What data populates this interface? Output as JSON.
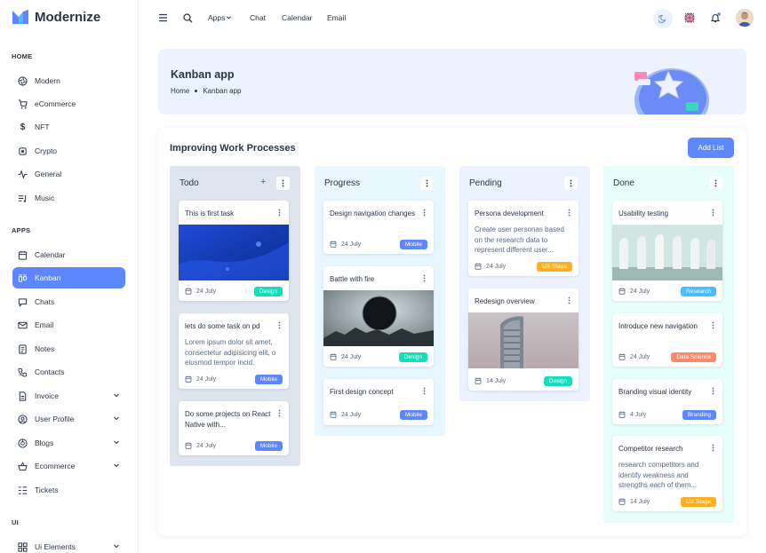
{
  "app": {
    "name": "Modernize"
  },
  "sidebar": {
    "sections": [
      {
        "caption": "HOME"
      },
      {
        "caption": "APPS"
      },
      {
        "caption": "UI"
      }
    ],
    "items": [
      {
        "label": "Modern",
        "icon": "aperture-icon"
      },
      {
        "label": "eCommerce",
        "icon": "shopping-cart-icon"
      },
      {
        "label": "NFT",
        "icon": "currency-dollar-icon"
      },
      {
        "label": "Crypto",
        "icon": "cpu-icon"
      },
      {
        "label": "General",
        "icon": "activity-icon"
      },
      {
        "label": "Music",
        "icon": "playlist-icon"
      },
      {
        "label": "Calendar",
        "icon": "calendar-icon"
      },
      {
        "label": "Kanban",
        "icon": "layout-kanban-icon"
      },
      {
        "label": "Chats",
        "icon": "message-icon"
      },
      {
        "label": "Email",
        "icon": "mail-icon"
      },
      {
        "label": "Notes",
        "icon": "notes-icon"
      },
      {
        "label": "Contacts",
        "icon": "phone-icon"
      },
      {
        "label": "Invoice",
        "icon": "file-text-icon"
      },
      {
        "label": "User Profile",
        "icon": "user-circle-icon"
      },
      {
        "label": "Blogs",
        "icon": "chart-donut-icon"
      },
      {
        "label": "Ecommerce",
        "icon": "basket-icon"
      },
      {
        "label": "Tickets",
        "icon": "ticket-icon"
      },
      {
        "label": "Ui Elements",
        "icon": "layout-grid-icon"
      }
    ]
  },
  "topbar": {
    "links": [
      "Apps",
      "Chat",
      "Calendar",
      "Email"
    ]
  },
  "hero": {
    "title": "Kanban app",
    "breadcrumb": [
      "Home",
      "Kanban app"
    ]
  },
  "board": {
    "title": "Improving Work Processes",
    "add_label": "Add List",
    "columns": [
      {
        "title": "Todo",
        "color": "#dfe5ef",
        "cards": [
          {
            "title": "This is first task",
            "date": "24 July",
            "badge": "Design"
          },
          {
            "title": "lets do some task on pd",
            "desc": "Lorem ipsum dolor sit amet, consectetur adipisicing elit, o eiusmod tempor incid.",
            "date": "24 July",
            "badge": "Mobile"
          },
          {
            "title": "Do some projects on React Native with...",
            "date": "24 July",
            "badge": "Mobile"
          }
        ]
      },
      {
        "title": "Progress",
        "color": "#e8f7ff",
        "cards": [
          {
            "title": "Design navigation changes",
            "date": "24 July",
            "badge": "Mobile"
          },
          {
            "title": "Battle with fire",
            "date": "24 July",
            "badge": "Design"
          },
          {
            "title": "First design concept",
            "date": "24 July",
            "badge": "Mobile"
          }
        ]
      },
      {
        "title": "Pending",
        "color": "#ecf2ff",
        "cards": [
          {
            "title": "Persona development",
            "desc": "Create user personas based on the research data to represent different user...",
            "date": "24 July",
            "badge": "UX Stage"
          },
          {
            "title": "Redesign overview",
            "date": "14 July",
            "badge": "Design"
          }
        ]
      },
      {
        "title": "Done",
        "color": "#e6fffa",
        "cards": [
          {
            "title": "Usability testing",
            "date": "24 July",
            "badge": "Research"
          },
          {
            "title": "Introduce new navigation",
            "date": "24 July",
            "badge": "Data Science"
          },
          {
            "title": "Branding visual identity",
            "date": "4 July",
            "badge": "Branding"
          },
          {
            "title": "Competitor research",
            "desc": "research competitors and identify weakness and strengths each of them...",
            "date": "14 July",
            "badge": "UX Stage"
          }
        ]
      }
    ]
  }
}
